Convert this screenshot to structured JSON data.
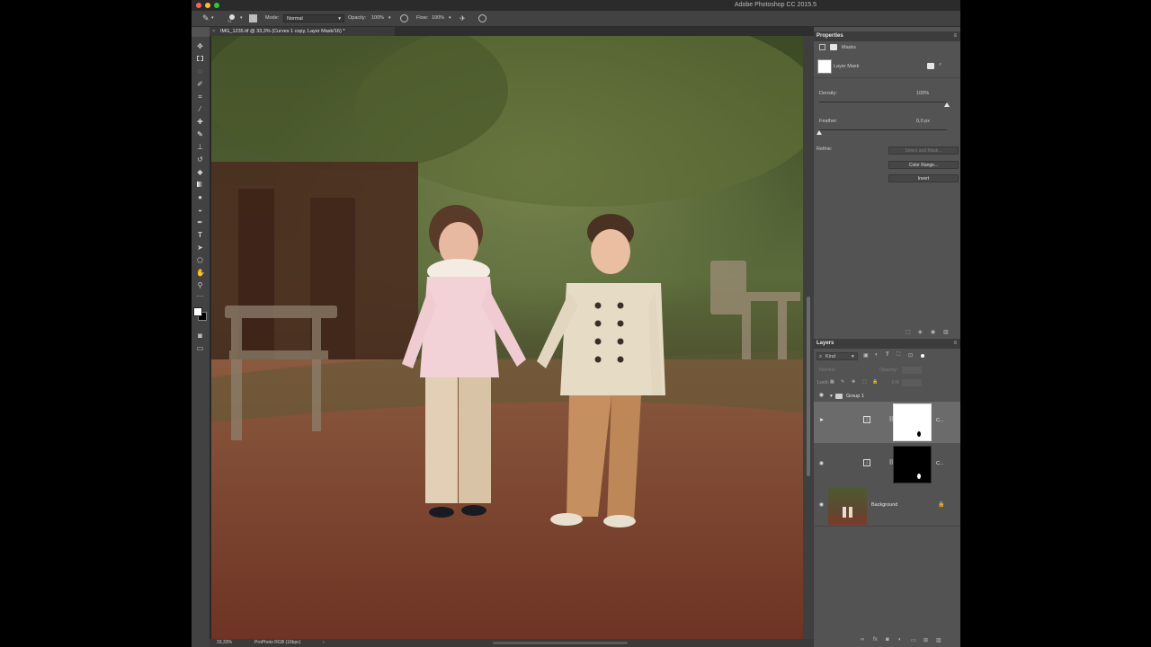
{
  "app": {
    "title": "Adobe Photoshop CC 2015.5",
    "traffic_colors": [
      "#ff5f57",
      "#febc2e",
      "#28c840"
    ]
  },
  "options_bar": {
    "brush_size": "71",
    "mode_label": "Mode:",
    "mode_value": "Normal",
    "opacity_label": "Opacity:",
    "opacity_value": "100%",
    "flow_label": "Flow:",
    "flow_value": "100%"
  },
  "document": {
    "tab_title": "IMG_1235.tif @ 33,3% (Curves 1 copy, Layer Mask/16) *",
    "zoom": "33,33%",
    "profile": "ProPhoto RGB (16bpc)"
  },
  "properties": {
    "title": "Properties",
    "subtitle": "Masks",
    "mask_label": "Layer Mask",
    "density_label": "Density:",
    "density_value": "100%",
    "density_level": 1.0,
    "feather_label": "Feather:",
    "feather_value": "0,0 px",
    "feather_level": 0.0,
    "refine_label": "Refine:",
    "select_and_mask": "Select and Mask...",
    "color_range": "Color Range...",
    "invert": "Invert"
  },
  "layers": {
    "title": "Layers",
    "filter_kind": "Kind",
    "blend_mode": "Normal",
    "opacity_label": "Opacity:",
    "lock_label": "Lock:",
    "fill_label": "Fill:",
    "items": [
      {
        "name": "Group 1",
        "type": "group"
      },
      {
        "name": "C...",
        "type": "adjustment",
        "mask": "white"
      },
      {
        "name": "C...",
        "type": "adjustment",
        "mask": "black"
      },
      {
        "name": "Background",
        "type": "pixel"
      }
    ]
  }
}
